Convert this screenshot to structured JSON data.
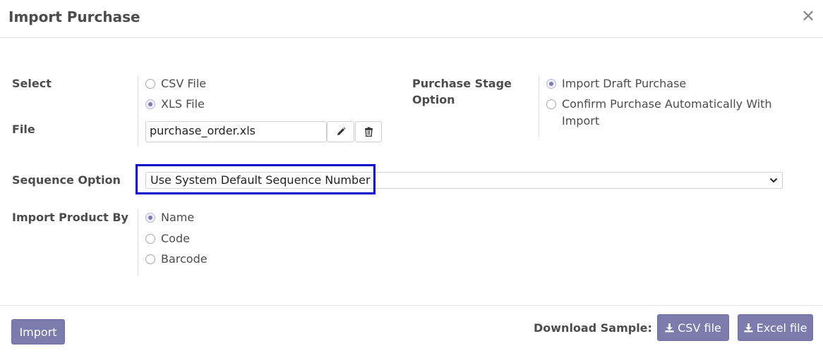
{
  "dialog": {
    "title": "Import Purchase",
    "close_icon": "close-icon"
  },
  "form": {
    "select_label": "Select",
    "file_type_options": [
      {
        "label": "CSV File",
        "checked": false
      },
      {
        "label": "XLS File",
        "checked": true
      }
    ],
    "file_label": "File",
    "file_value": "purchase_order.xls",
    "edit_icon": "pencil-icon",
    "delete_icon": "trash-icon",
    "purchase_stage_label": "Purchase Stage Option",
    "purchase_stage_label_line1": "Purchase Stage",
    "purchase_stage_label_line2": "Option",
    "stage_options": [
      {
        "label": "Import Draft Purchase",
        "checked": true
      },
      {
        "label": "Confirm Purchase Automatically With Import",
        "line1": "Confirm Purchase Automatically With",
        "line2": "Import",
        "checked": false
      }
    ],
    "sequence_label": "Sequence Option",
    "sequence_value": "Use System Default Sequence Number",
    "import_product_label": "Import Product By",
    "product_by_options": [
      {
        "label": "Name",
        "checked": true
      },
      {
        "label": "Code",
        "checked": false
      },
      {
        "label": "Barcode",
        "checked": false
      }
    ]
  },
  "footer": {
    "import_button": "Import",
    "download_sample_label": "Download Sample:",
    "csv_button": "CSV file",
    "excel_button": "Excel file",
    "download_icon": "download-icon"
  },
  "colors": {
    "accent": "#7c7bad",
    "highlight": "#0000cc"
  }
}
